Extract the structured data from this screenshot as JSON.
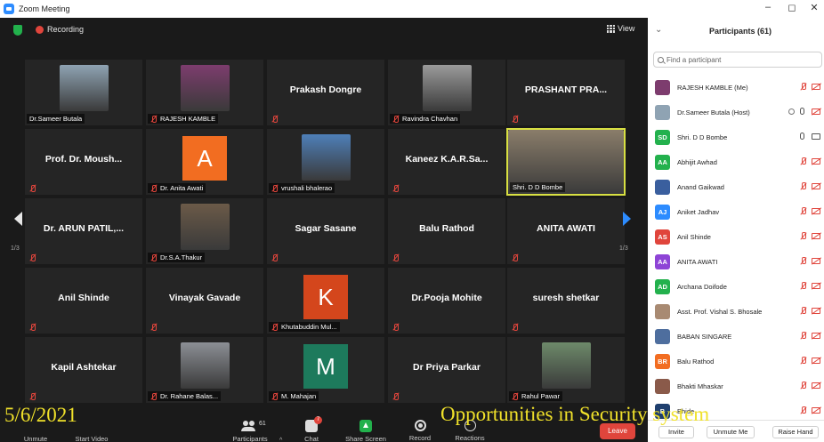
{
  "window": {
    "title": "Zoom Meeting"
  },
  "meeting": {
    "recording_label": "Recording",
    "view_label": "View",
    "page_indicator_left": "1/3",
    "page_indicator_right": "1/3",
    "tiles": [
      {
        "big": "",
        "name": "Dr.Sameer Butala",
        "muted": false,
        "photo": "#8fa3b3",
        "letter": "",
        "letter_bg": ""
      },
      {
        "big": "",
        "name": "RAJESH KAMBLE",
        "muted": true,
        "photo": "#7d3c6e",
        "letter": "",
        "letter_bg": ""
      },
      {
        "big": "Prakash Dongre",
        "name": "",
        "muted": true,
        "photo": "",
        "letter": "",
        "letter_bg": ""
      },
      {
        "big": "",
        "name": "Ravindra Chavhan",
        "muted": true,
        "photo": "#9b9b9b",
        "letter": "",
        "letter_bg": ""
      },
      {
        "big": "PRASHANT PRA...",
        "name": "",
        "muted": true,
        "photo": "",
        "letter": "",
        "letter_bg": ""
      },
      {
        "big": "Prof. Dr. Moush...",
        "name": "",
        "muted": true,
        "photo": "",
        "letter": "",
        "letter_bg": ""
      },
      {
        "big": "",
        "name": "Dr. Anita Awati",
        "muted": true,
        "photo": "",
        "letter": "A",
        "letter_bg": "#f26d21"
      },
      {
        "big": "",
        "name": "vrushali bhalerao",
        "muted": true,
        "photo": "#4e7fb8",
        "letter": "",
        "letter_bg": ""
      },
      {
        "big": "Kaneez K.A.R.Sa...",
        "name": "",
        "muted": true,
        "photo": "",
        "letter": "",
        "letter_bg": ""
      },
      {
        "big": "",
        "name": "Shri. D D Bombe",
        "muted": false,
        "photo": "#8a7d6a",
        "letter": "",
        "letter_bg": "",
        "active": true
      },
      {
        "big": "Dr. ARUN PATIL,...",
        "name": "",
        "muted": true,
        "photo": "",
        "letter": "",
        "letter_bg": ""
      },
      {
        "big": "",
        "name": "Dr.S.A.Thakur",
        "muted": true,
        "photo": "#6b5a48",
        "letter": "",
        "letter_bg": ""
      },
      {
        "big": "Sagar Sasane",
        "name": "",
        "muted": true,
        "photo": "",
        "letter": "",
        "letter_bg": ""
      },
      {
        "big": "Balu Rathod",
        "name": "",
        "muted": true,
        "photo": "",
        "letter": "",
        "letter_bg": ""
      },
      {
        "big": "ANITA AWATI",
        "name": "",
        "muted": true,
        "photo": "",
        "letter": "",
        "letter_bg": ""
      },
      {
        "big": "Anil Shinde",
        "name": "",
        "muted": true,
        "photo": "",
        "letter": "",
        "letter_bg": ""
      },
      {
        "big": "Vinayak Gavade",
        "name": "",
        "muted": true,
        "photo": "",
        "letter": "",
        "letter_bg": ""
      },
      {
        "big": "",
        "name": "Khutabuddin Mul...",
        "muted": true,
        "photo": "",
        "letter": "K",
        "letter_bg": "#d4461c"
      },
      {
        "big": "Dr.Pooja Mohite",
        "name": "",
        "muted": true,
        "photo": "",
        "letter": "",
        "letter_bg": ""
      },
      {
        "big": "suresh shetkar",
        "name": "",
        "muted": true,
        "photo": "",
        "letter": "",
        "letter_bg": ""
      },
      {
        "big": "Kapil Ashtekar",
        "name": "",
        "muted": true,
        "photo": "",
        "letter": "",
        "letter_bg": ""
      },
      {
        "big": "",
        "name": "Dr. Rahane Balas...",
        "muted": true,
        "photo": "#8c8f95",
        "letter": "",
        "letter_bg": ""
      },
      {
        "big": "",
        "name": "M. Mahajan",
        "muted": true,
        "photo": "",
        "letter": "M",
        "letter_bg": "#1d7a5c"
      },
      {
        "big": "Dr Priya Parkar",
        "name": "",
        "muted": true,
        "photo": "",
        "letter": "",
        "letter_bg": ""
      },
      {
        "big": "",
        "name": "Rahul Pawar",
        "muted": true,
        "photo": "#6e8a6a",
        "letter": "",
        "letter_bg": ""
      }
    ]
  },
  "toolbar": {
    "unmute": "Unmute",
    "start_video": "Start Video",
    "participants": "Participants",
    "participants_count": "61",
    "chat": "Chat",
    "chat_badge": "7",
    "share_screen": "Share Screen",
    "record": "Record",
    "reactions": "Reactions",
    "leave": "Leave"
  },
  "overlay": {
    "date": "5/6/2021",
    "topic": "Opportunities in Security system"
  },
  "panel": {
    "title": "Participants (61)",
    "search_placeholder": "Find a participant",
    "participants": [
      {
        "name": "RAJESH KAMBLE (Me)",
        "initials": "",
        "color": "#7d3c6e",
        "mic": "off",
        "cam": "off",
        "extra": false
      },
      {
        "name": "Dr.Sameer Butala (Host)",
        "initials": "",
        "color": "#8fa3b3",
        "mic": "on",
        "cam": "off",
        "extra": true
      },
      {
        "name": "Shri. D D Bombe",
        "initials": "SD",
        "color": "#23b14d",
        "mic": "on",
        "cam": "on",
        "extra": false
      },
      {
        "name": "Abhijit Awhad",
        "initials": "AA",
        "color": "#23b14d",
        "mic": "off",
        "cam": "off",
        "extra": false
      },
      {
        "name": "Anand Gaikwad",
        "initials": "",
        "color": "#3a5f9e",
        "mic": "off",
        "cam": "off",
        "extra": false
      },
      {
        "name": "Aniket Jadhav",
        "initials": "AJ",
        "color": "#2d8cff",
        "mic": "off",
        "cam": "off",
        "extra": false
      },
      {
        "name": "Anil Shinde",
        "initials": "AS",
        "color": "#e0453c",
        "mic": "off",
        "cam": "off",
        "extra": false
      },
      {
        "name": "ANITA AWATI",
        "initials": "AA",
        "color": "#8e44d6",
        "mic": "off",
        "cam": "off",
        "extra": false
      },
      {
        "name": "Archana Doifode",
        "initials": "AD",
        "color": "#23b14d",
        "mic": "off",
        "cam": "off",
        "extra": false
      },
      {
        "name": "Asst. Prof. Vishal S. Bhosale",
        "initials": "",
        "color": "#a88a72",
        "mic": "off",
        "cam": "off",
        "extra": false
      },
      {
        "name": "BABAN SINGARE",
        "initials": "",
        "color": "#4e6e9e",
        "mic": "off",
        "cam": "off",
        "extra": false
      },
      {
        "name": "Balu Rathod",
        "initials": "BR",
        "color": "#f26d21",
        "mic": "off",
        "cam": "off",
        "extra": false
      },
      {
        "name": "Bhakti Mhaskar",
        "initials": "",
        "color": "#8a5a4a",
        "mic": "off",
        "cam": "off",
        "extra": false
      },
      {
        "name": "Bhide",
        "initials": "B",
        "color": "#1f3f6e",
        "mic": "off",
        "cam": "off",
        "extra": false
      }
    ],
    "invite": "Invite",
    "unmute_me": "Unmute Me",
    "raise_hand": "Raise Hand"
  }
}
